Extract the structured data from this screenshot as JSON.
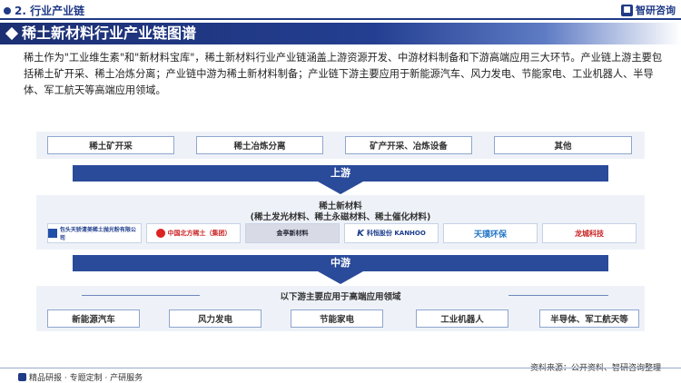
{
  "header": {
    "section_title": "2. 行业产业链",
    "brand": "智研咨询"
  },
  "banner": {
    "title": "稀土新材料行业产业链图谱"
  },
  "intro": "稀土作为\"工业维生素\"和\"新材料宝库\"，稀土新材料行业产业链涵盖上游资源开发、中游材料制备和下游高端应用三大环节。产业链上游主要包括稀土矿开采、稀土冶炼分离；产业链中游为稀土新材料制备；产业链下游主要应用于新能源汽车、风力发电、节能家电、工业机器人、半导体、军工航天等高端应用领域。",
  "upstream": {
    "items": [
      "稀土矿开采",
      "稀土冶炼分离",
      "矿产开采、冶炼设备",
      "其他"
    ],
    "label": "上游"
  },
  "midstream": {
    "title": "稀土新材料",
    "subtitle": "(稀土发光材料、稀土永磁材料、稀土催化材料)",
    "logos": [
      {
        "text": "包头天骄清美稀土抛光粉有限公司",
        "icon": "tianjiao-logo"
      },
      {
        "text": "中国北方稀土（集团）",
        "icon": "northern-rare-earth-logo"
      },
      {
        "text": "金亭新材料",
        "icon": "jinting-logo"
      },
      {
        "text": "科恒股份 KANHOO",
        "icon": "kanhoo-logo"
      },
      {
        "text": "天璞环保",
        "icon": "tianpu-logo"
      },
      {
        "text": "龙城科技",
        "icon": "hcpeel-logo"
      }
    ],
    "label": "中游"
  },
  "downstream": {
    "title": "以下游主要应用于高端应用领域",
    "items": [
      "新能源汽车",
      "风力发电",
      "节能家电",
      "工业机器人",
      "半导体、军工航天等"
    ]
  },
  "footer": {
    "left": "精品研报 · 专题定制 · 产研服务",
    "right": "资料来源：公开资料、智研咨询整理"
  },
  "colors": {
    "primary": "#1f3a86",
    "band": "#2a4a9a"
  }
}
